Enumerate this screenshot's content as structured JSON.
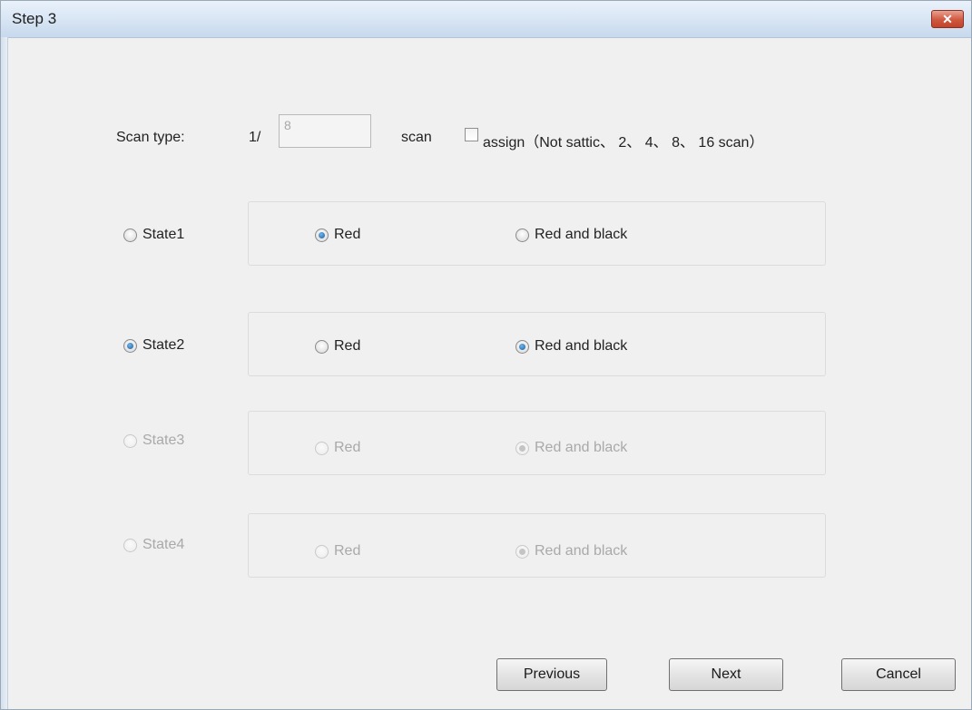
{
  "window": {
    "title": "Step 3",
    "close_label": "✕"
  },
  "scan": {
    "label": "Scan type:",
    "prefix": "1/",
    "value": "8",
    "unit": "scan",
    "assign_label": "assign（Not sattic、 2、 4、 8、 16 scan）",
    "assign_checked": false
  },
  "states": [
    {
      "label": "State1",
      "selected": false,
      "enabled": true,
      "red_label": "Red",
      "rb_label": "Red and black",
      "option": "red"
    },
    {
      "label": "State2",
      "selected": true,
      "enabled": true,
      "red_label": "Red",
      "rb_label": "Red and black",
      "option": "red-and-black"
    },
    {
      "label": "State3",
      "selected": false,
      "enabled": false,
      "red_label": "Red",
      "rb_label": "Red and black",
      "option": "red-and-black"
    },
    {
      "label": "State4",
      "selected": false,
      "enabled": false,
      "red_label": "Red",
      "rb_label": "Red and black",
      "option": "red-and-black"
    }
  ],
  "buttons": {
    "previous": "Previous",
    "next": "Next",
    "cancel": "Cancel"
  }
}
